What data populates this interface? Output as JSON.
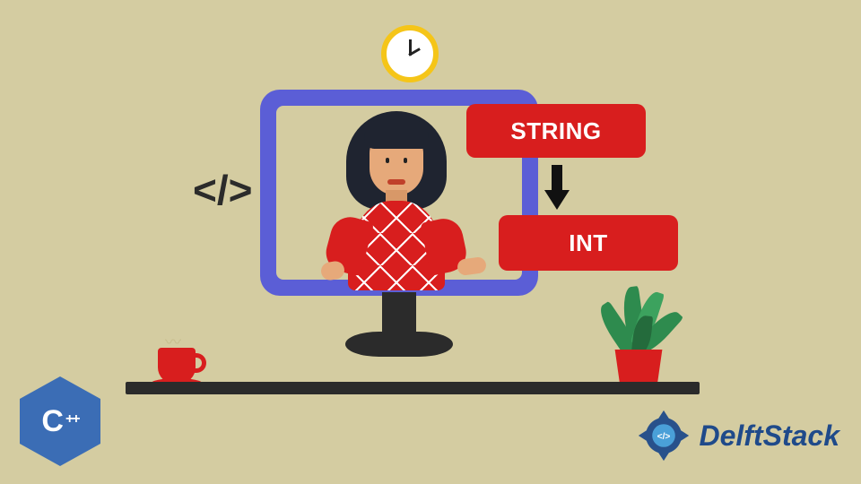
{
  "labels": {
    "string": "STRING",
    "int": "INT"
  },
  "code_bracket": "</>",
  "logos": {
    "cpp_letter": "C",
    "cpp_pluses": "++",
    "brand_name": "DelftStack",
    "brand_mark_text": "</>"
  },
  "icons": {
    "clock": "clock-icon",
    "arrow_down": "arrow-down-icon",
    "code_bracket": "code-bracket-icon",
    "cup": "coffee-cup-icon",
    "plant": "plant-icon",
    "monitor": "monitor-icon",
    "person": "person-illustration"
  }
}
